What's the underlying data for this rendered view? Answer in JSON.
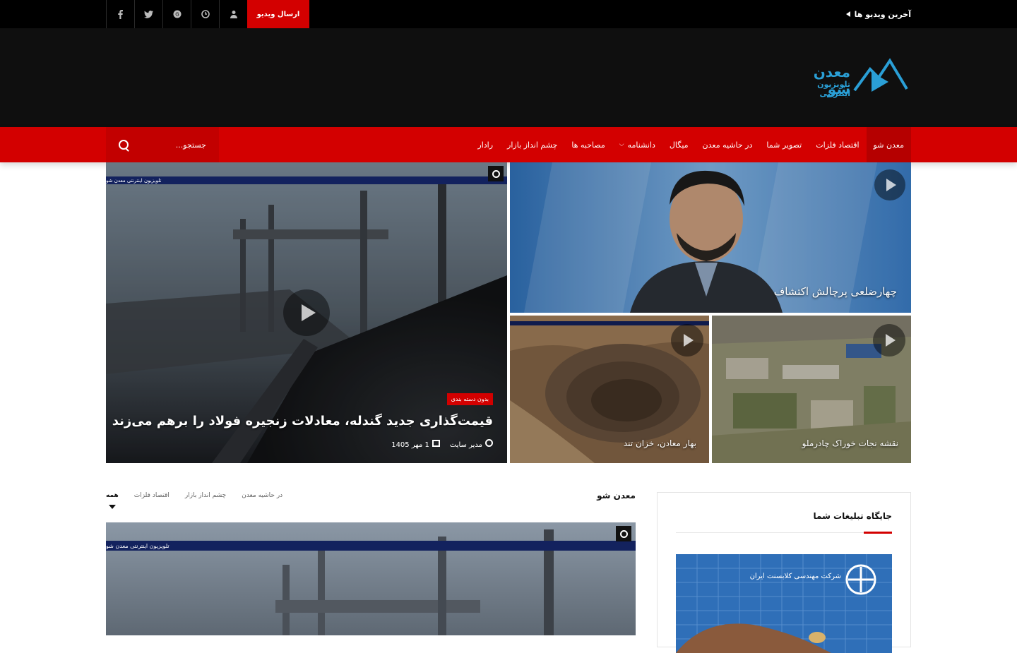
{
  "topbar": {
    "latest_label": "آخرین ویدیو ها",
    "send_video_label": "ارسال ویدیو",
    "icons": [
      "user-icon",
      "clock-icon",
      "google-plus-icon",
      "twitter-icon",
      "facebook-icon"
    ]
  },
  "logo": {
    "name": "معدن شو",
    "tagline": "تلویزیون اینترنتی"
  },
  "nav": {
    "items": [
      {
        "label": "معدن شو",
        "active": true
      },
      {
        "label": "اقتصاد فلزات"
      },
      {
        "label": "تصویر شما"
      },
      {
        "label": "در حاشیه معدن"
      },
      {
        "label": "میگال"
      },
      {
        "label": "دانشنامه",
        "has_dropdown": true
      },
      {
        "label": "مصاحبه ها"
      },
      {
        "label": "چشم انداز بازار"
      },
      {
        "label": "رادار"
      }
    ],
    "search_placeholder": "جستجو..."
  },
  "hero": {
    "main": {
      "strip_text": "تلویزیون اینترنتی معدن شو",
      "category": "بدون دسته بندی",
      "title": "قیمت‌گذاری جدید گندله، معادلات زنجیره فولاد را برهم می‌زند",
      "author": "مدیر سایت",
      "date": "1 مهر 1405"
    },
    "top_right": {
      "title": "چهارضلعی پرچالش اکتشاف"
    },
    "bottom_left": {
      "title": "بهار معادن، خزان تند"
    },
    "bottom_right": {
      "title": "نقشه نجات خوراک چادرملو"
    }
  },
  "section": {
    "title": "معدن شو",
    "tabs": [
      {
        "label": "همه",
        "active": true
      },
      {
        "label": "اقتصاد فلزات"
      },
      {
        "label": "چشم انداز بازار"
      },
      {
        "label": "در حاشیه معدن"
      }
    ],
    "strip_text": "تلویزیون اینترنتی معدن شو"
  },
  "sidebar": {
    "title": "جایگاه تبلیغات شما",
    "ad_text": "شرکت مهندسی کلابسنت ایران"
  },
  "colors": {
    "accent": "#d30000",
    "logo_blue": "#2a9fd6",
    "topbar": "#000000",
    "header": "#0f0f0f"
  }
}
